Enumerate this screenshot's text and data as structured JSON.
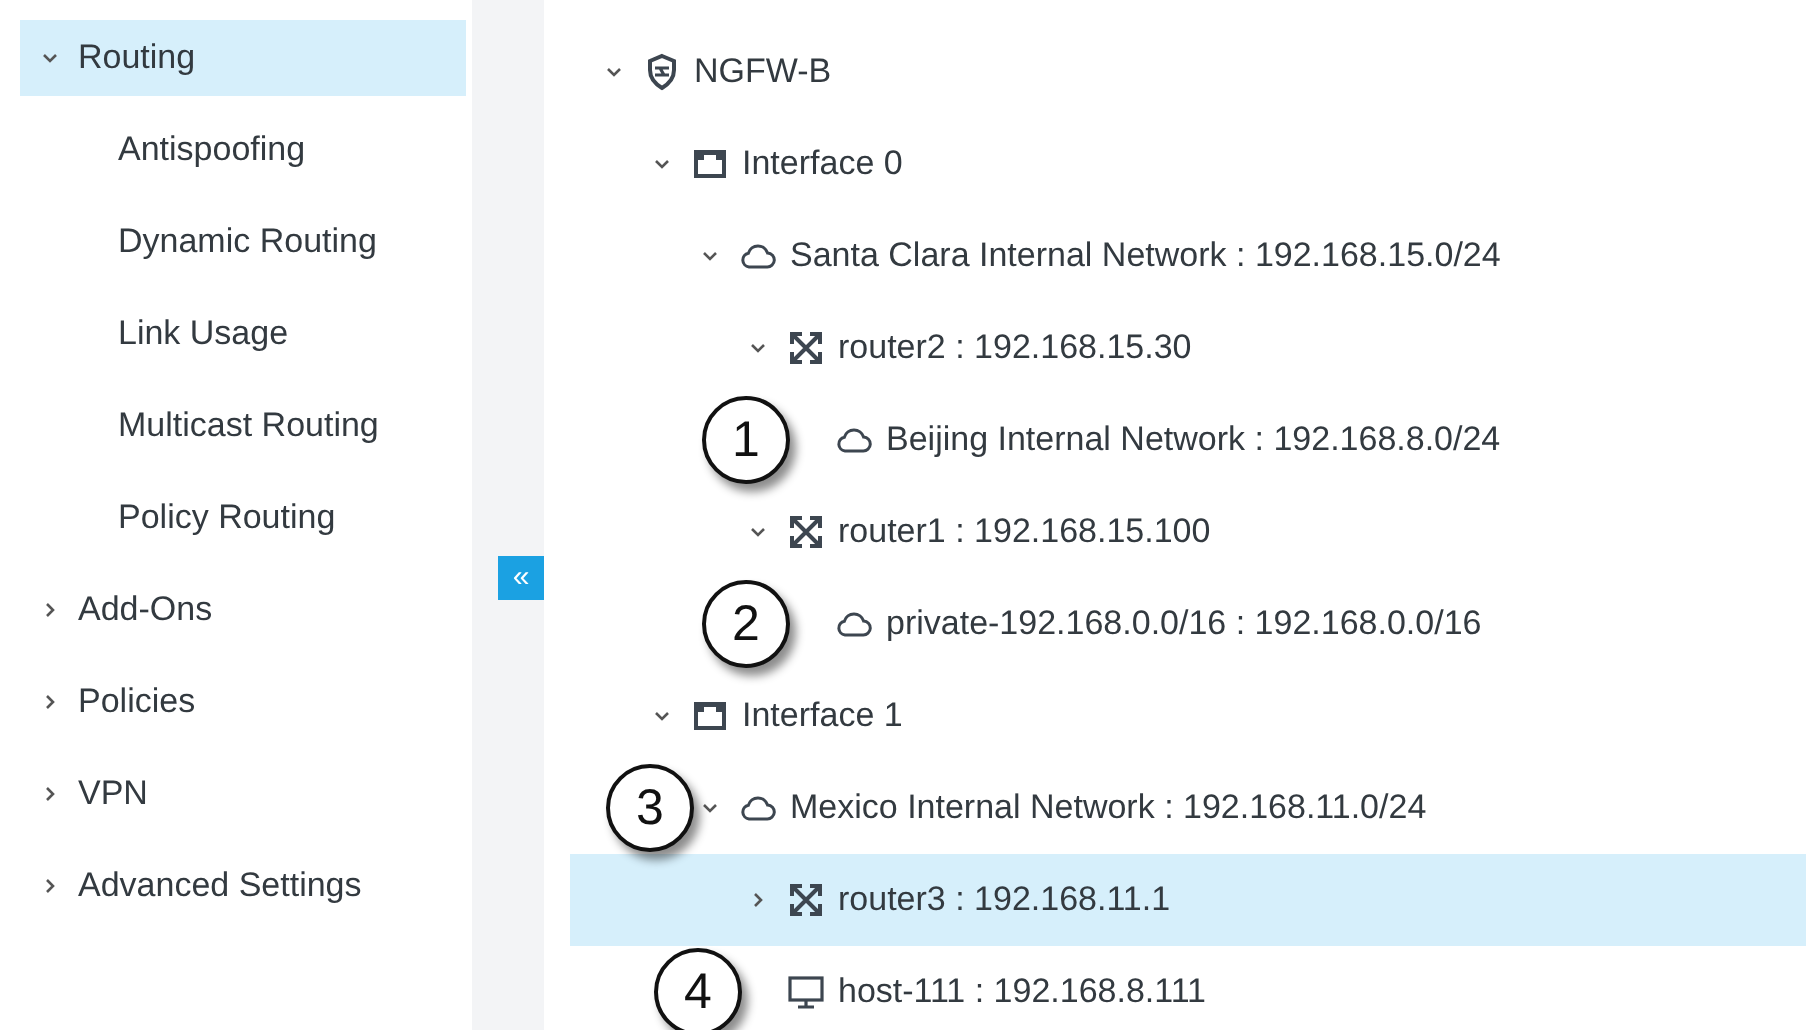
{
  "sidebar": {
    "items": [
      {
        "label": "Routing",
        "expanded": true,
        "selected": true,
        "children": [
          {
            "label": "Antispoofing",
            "selected": false
          },
          {
            "label": "Dynamic Routing",
            "selected": false
          },
          {
            "label": "Link Usage",
            "selected": false
          },
          {
            "label": "Multicast Routing",
            "selected": false
          },
          {
            "label": "Policy Routing",
            "selected": false
          }
        ]
      },
      {
        "label": "Add-Ons",
        "expanded": false,
        "selected": false
      },
      {
        "label": "Policies",
        "expanded": false,
        "selected": false
      },
      {
        "label": "VPN",
        "expanded": false,
        "selected": false
      },
      {
        "label": "Advanced Settings",
        "expanded": false,
        "selected": false
      }
    ]
  },
  "collapse_button": {
    "label": "«"
  },
  "tree": [
    {
      "kind": "firewall",
      "label": "NGFW-B",
      "expanded": true,
      "selected": false,
      "children": [
        {
          "kind": "interface",
          "label": "Interface 0",
          "expanded": true,
          "selected": false,
          "children": [
            {
              "kind": "network",
              "label": "Santa Clara Internal Network : 192.168.15.0/24",
              "expanded": true,
              "selected": false,
              "children": [
                {
                  "kind": "router",
                  "label": "router2 : 192.168.15.30",
                  "expanded": true,
                  "selected": false,
                  "children": [
                    {
                      "kind": "network",
                      "label": "Beijing Internal Network : 192.168.8.0/24",
                      "selected": false,
                      "callout": "1"
                    }
                  ]
                },
                {
                  "kind": "router",
                  "label": "router1 : 192.168.15.100",
                  "expanded": true,
                  "selected": false,
                  "children": [
                    {
                      "kind": "network",
                      "label": "private-192.168.0.0/16 : 192.168.0.0/16",
                      "selected": false,
                      "callout": "2"
                    }
                  ]
                }
              ]
            }
          ]
        },
        {
          "kind": "interface",
          "label": "Interface 1",
          "expanded": true,
          "selected": false,
          "children": [
            {
              "kind": "network",
              "label": "Mexico Internal Network : 192.168.11.0/24",
              "expanded": true,
              "selected": false,
              "callout": "3",
              "children": [
                {
                  "kind": "router",
                  "label": "router3 : 192.168.11.1",
                  "expanded": false,
                  "selected": true
                },
                {
                  "kind": "host",
                  "label": "host-111 : 192.168.8.111",
                  "selected": false,
                  "callout": "4"
                }
              ]
            }
          ]
        }
      ]
    }
  ]
}
